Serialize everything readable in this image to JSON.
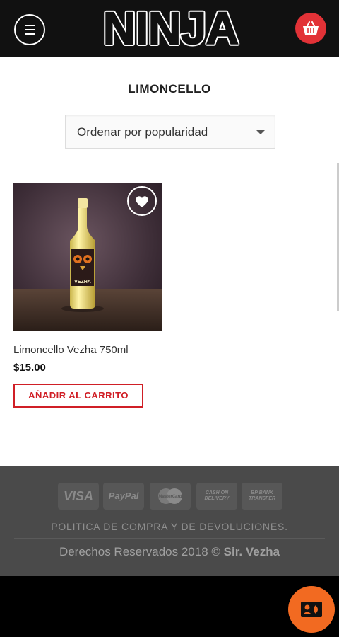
{
  "header": {
    "logo_text": "NINJA",
    "menu_icon": "hamburger-menu-icon",
    "cart_icon": "shopping-basket-icon"
  },
  "page": {
    "title": "LIMONCELLO"
  },
  "sort": {
    "selected": "Ordenar por popularidad"
  },
  "products": [
    {
      "name": "Limoncello Vezha 750ml",
      "price": "$15.00",
      "button_label": "AÑADIR AL CARRITO",
      "bottle_label": "VEZHA"
    }
  ],
  "footer": {
    "payments": {
      "visa": "VISA",
      "paypal": "PayPal",
      "mastercard": "MasterCard",
      "cod_line1": "CASH ON",
      "cod_line2": "DELIVERY",
      "bank_line1": "BP BANK",
      "bank_line2": "TRANSFER"
    },
    "policy_link": "POLITICA DE COMPRA Y DE DEVOLUCIONES.",
    "copyright_prefix": "Derechos Reservados 2018 ©",
    "copyright_owner": "Sir. Vezha"
  },
  "colors": {
    "brand_red": "#e23237",
    "accent_orange": "#f26a21",
    "header_bg": "#111111",
    "footer_bg": "#4a4a4a"
  }
}
